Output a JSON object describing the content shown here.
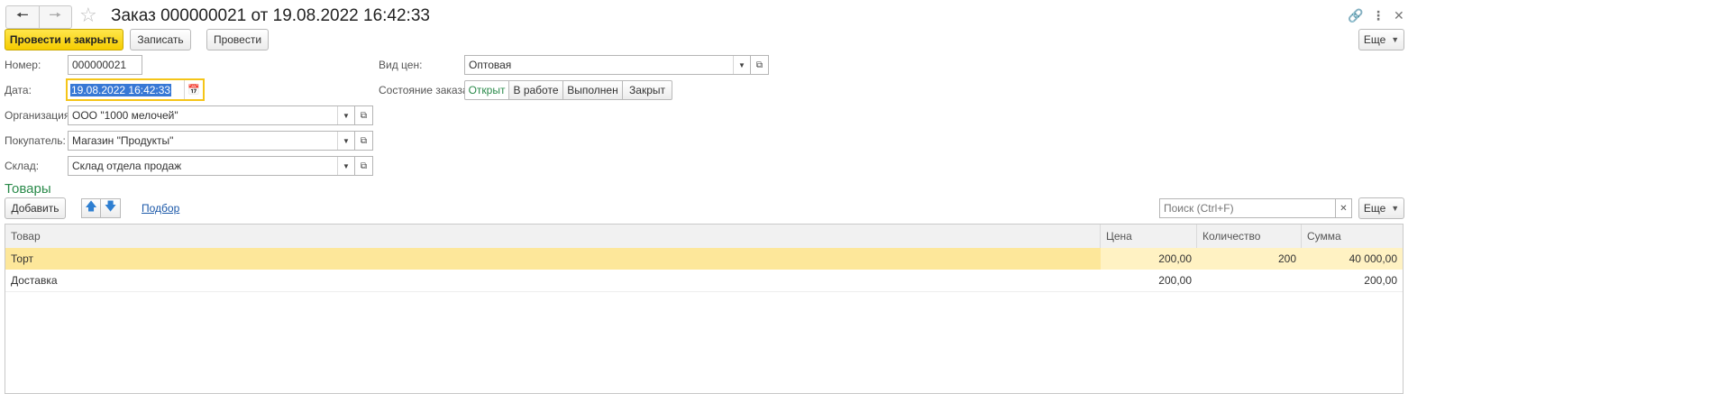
{
  "window": {
    "title": "Заказ 000000021 от 19.08.2022 16:42:33",
    "icons": {
      "back": "arrow-left-icon",
      "forward": "arrow-right-icon",
      "favorite": "star-icon",
      "link": "link-icon",
      "more": "more-vertical-icon",
      "close": "close-icon"
    }
  },
  "toolbar": {
    "post_close_label": "Провести и закрыть",
    "save_label": "Записать",
    "post_label": "Провести",
    "more_label": "Еще"
  },
  "form": {
    "number_label": "Номер:",
    "number_value": "000000021",
    "date_label": "Дата:",
    "date_value": "19.08.2022 16:42:33",
    "org_label": "Организация:",
    "org_value": "ООО \"1000 мелочей\"",
    "buyer_label": "Покупатель:",
    "buyer_value": "Магазин \"Продукты\"",
    "warehouse_label": "Склад:",
    "warehouse_value": "Склад отдела продаж",
    "price_type_label": "Вид цен:",
    "price_type_value": "Оптовая",
    "status_label": "Состояние заказа:",
    "status_options": [
      "Открыт",
      "В работе",
      "Выполнен",
      "Закрыт"
    ],
    "status_selected": "Открыт"
  },
  "goods": {
    "section_title": "Товары",
    "add_label": "Добавить",
    "pick_label": "Подбор",
    "search_placeholder": "Поиск (Ctrl+F)",
    "more_label": "Еще",
    "columns": [
      "Товар",
      "Цена",
      "Количество",
      "Сумма"
    ],
    "rows": [
      {
        "item": "Торт",
        "price": "200,00",
        "qty": "200",
        "sum": "40 000,00"
      },
      {
        "item": "Доставка",
        "price": "200,00",
        "qty": "",
        "sum": "200,00"
      }
    ]
  },
  "colors": {
    "accent_yellow": "#f5cc00",
    "accent_green": "#2a8a4a",
    "row_highlight": "#fde79a",
    "link_blue": "#1a57a8"
  }
}
